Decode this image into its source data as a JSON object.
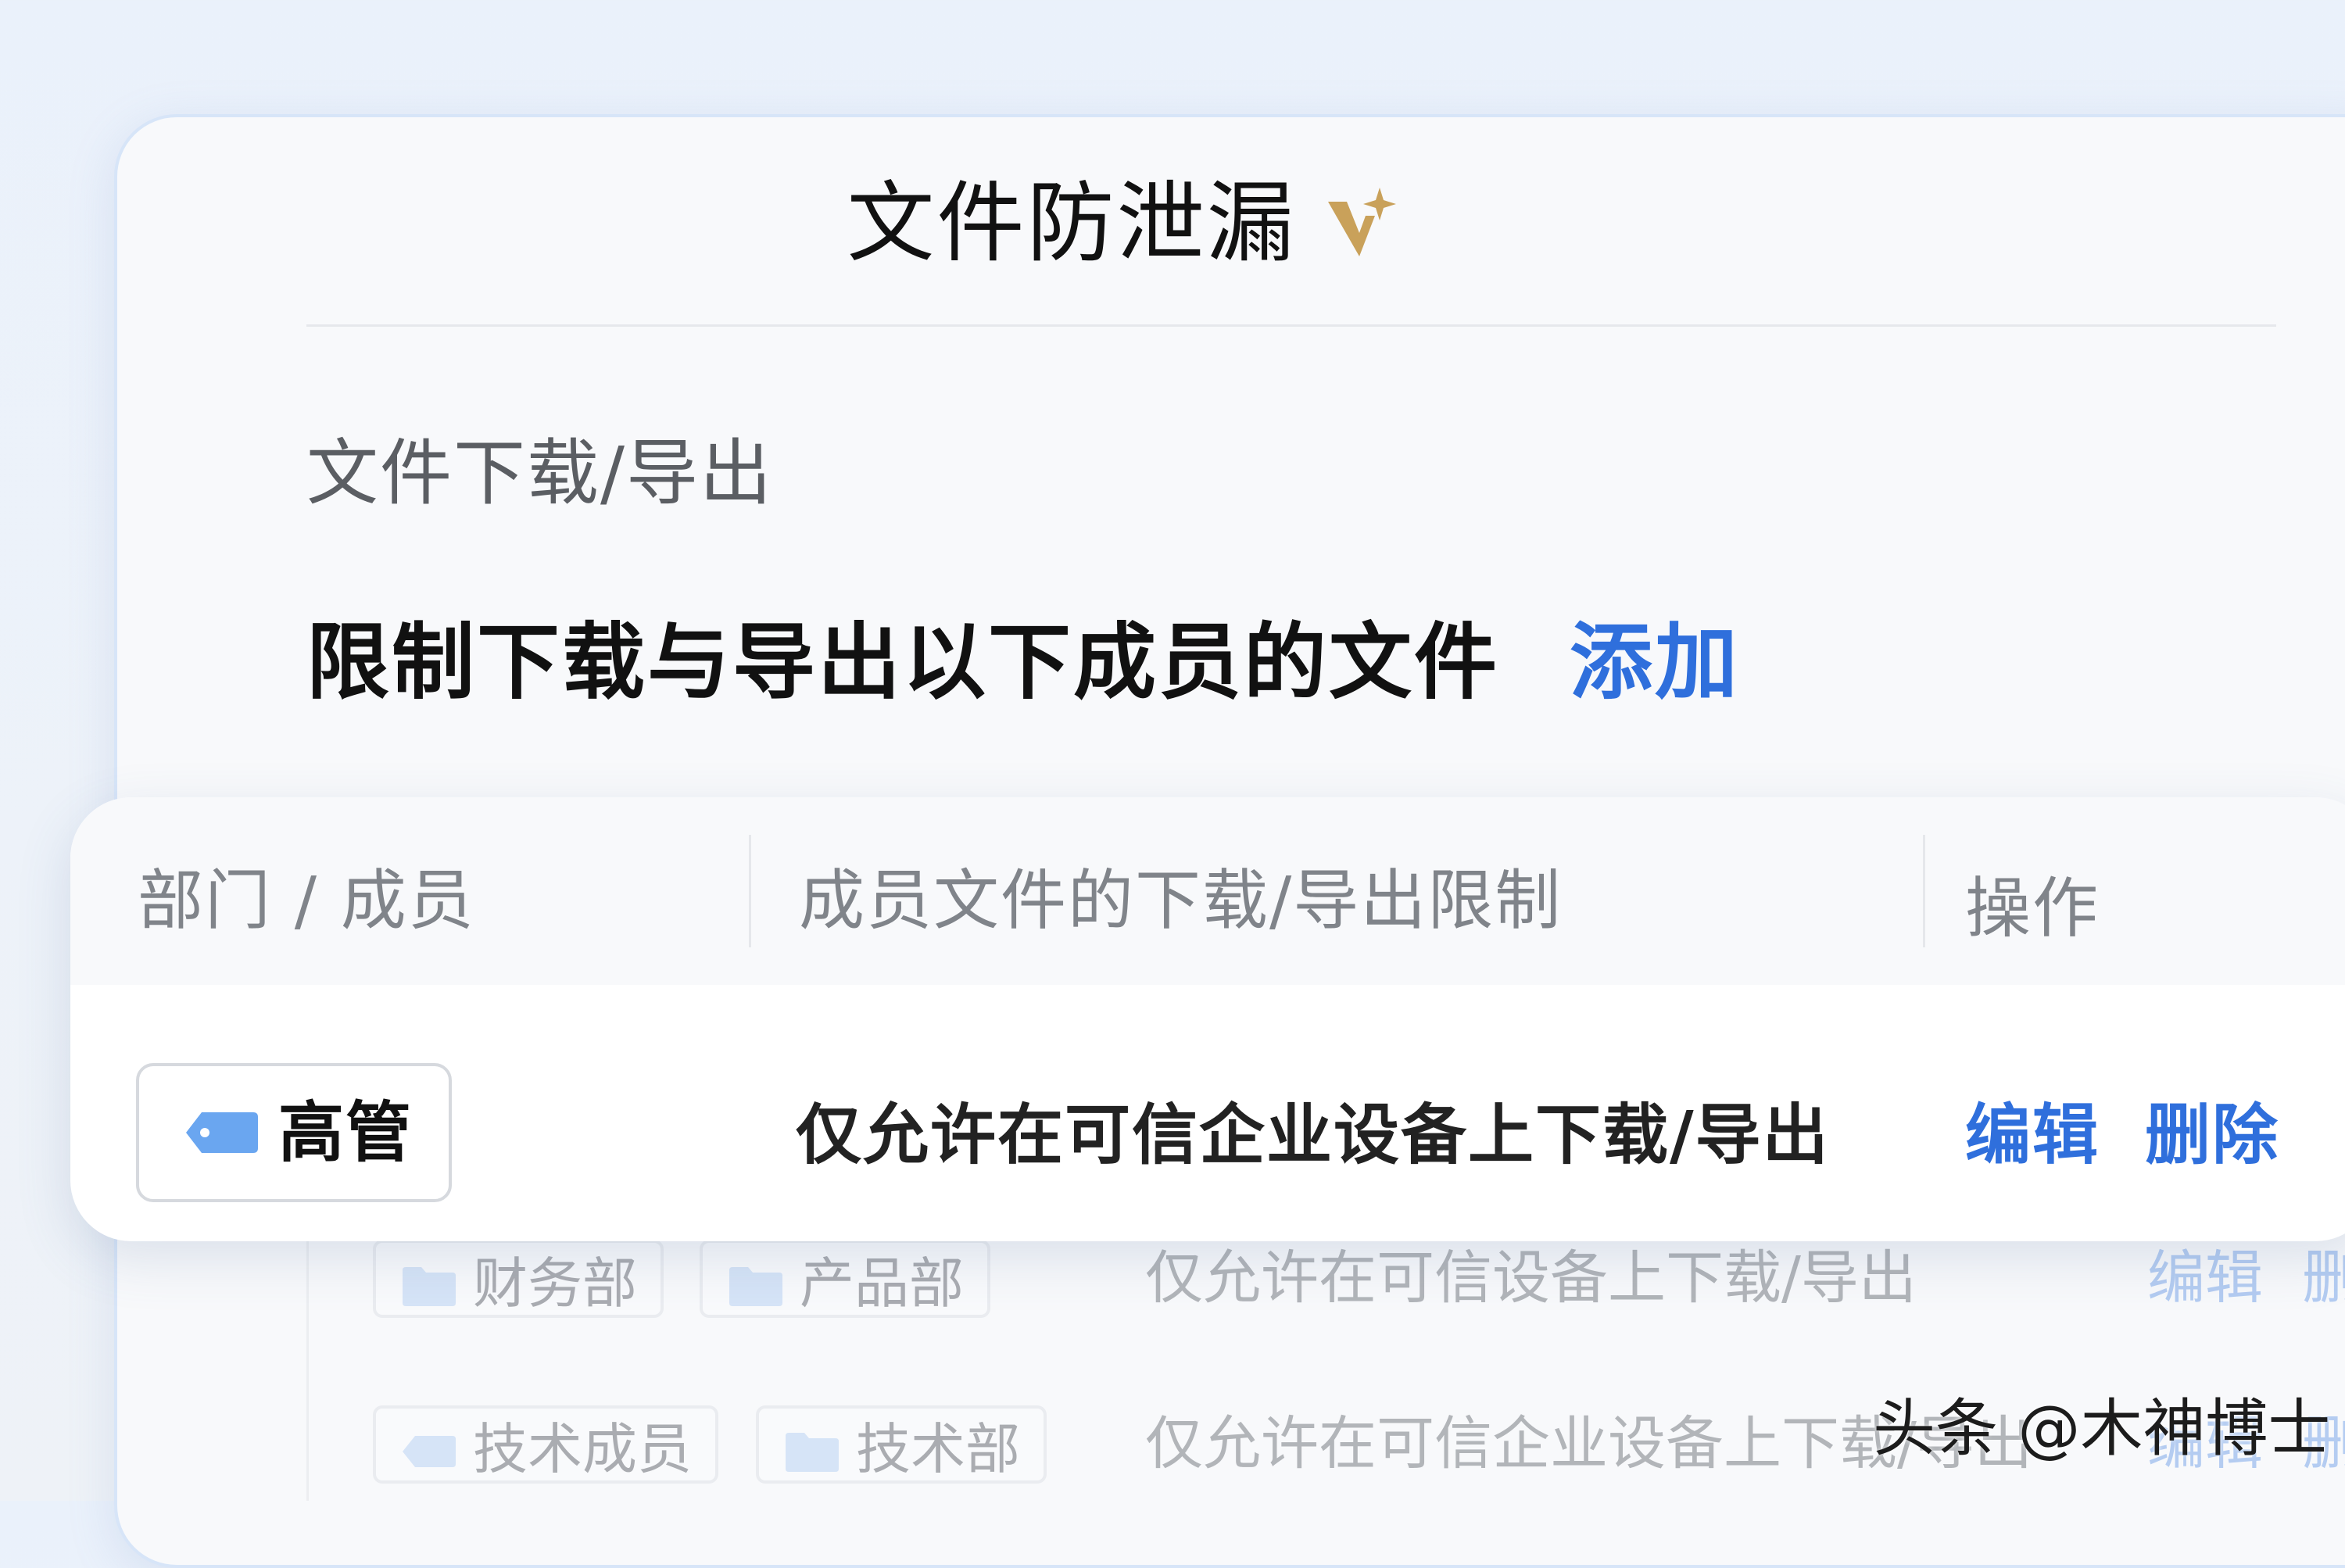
{
  "page": {
    "title": "文件防泄漏",
    "title_badge_icon": "sparkle-v-icon",
    "badge_color": "#c9a15a"
  },
  "section": {
    "title": "文件下载/导出"
  },
  "rule": {
    "text": "限制下载与导出以下成员的文件",
    "add_label": "添加",
    "accent_color": "#2f6fdc"
  },
  "table": {
    "headers": [
      "部门 / 成员",
      "成员文件的下载/导出限制",
      "操作"
    ],
    "rows": [
      {
        "tags": [
          {
            "icon": "tag-icon",
            "label": "高管"
          }
        ],
        "limit": "仅允许在可信企业设备上下载/导出",
        "actions": [
          "编辑",
          "删除"
        ]
      }
    ]
  },
  "background_rows": [
    {
      "tags": [
        {
          "icon": "folder-icon",
          "label": "财务部"
        },
        {
          "icon": "folder-icon",
          "label": "产品部"
        }
      ],
      "limit": "仅允许在可信设备上下载/导出",
      "actions": [
        "编辑",
        "删"
      ]
    },
    {
      "tags": [
        {
          "icon": "tag-icon",
          "label": "技术成员"
        },
        {
          "icon": "folder-icon",
          "label": "技术部"
        }
      ],
      "limit": "仅允许在可信企业设备上下载/导出",
      "actions": [
        "编辑",
        "删"
      ]
    }
  ],
  "watermark": {
    "text": "头条 @木神博士"
  }
}
